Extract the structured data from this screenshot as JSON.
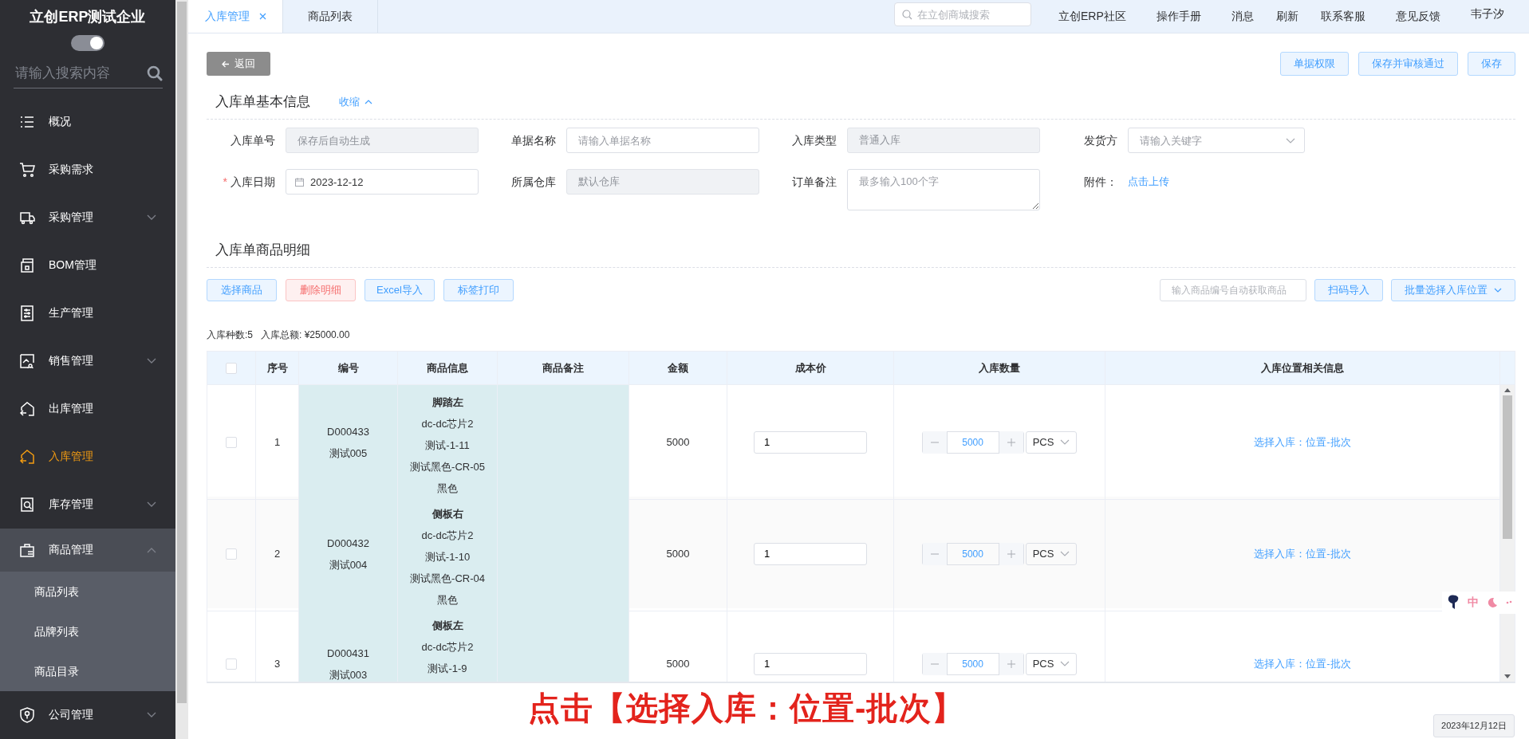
{
  "sidebar": {
    "title": "立创ERP测试企业",
    "toggle": {
      "on": true
    },
    "search": {
      "placeholder": "请输入搜索内容"
    },
    "items": [
      {
        "label": "概况",
        "selected": false
      },
      {
        "label": "采购需求",
        "selected": false
      },
      {
        "label": "采购管理",
        "selected": false,
        "expanded": false
      },
      {
        "label": "BOM管理",
        "selected": false
      },
      {
        "label": "生产管理",
        "selected": false
      },
      {
        "label": "销售管理",
        "selected": false,
        "expanded": false
      },
      {
        "label": "出库管理",
        "selected": false
      },
      {
        "label": "入库管理",
        "selected": true
      },
      {
        "label": "库存管理",
        "selected": false,
        "expanded": false
      },
      {
        "label": "商品管理",
        "selected": false,
        "expanded": true,
        "children": [
          {
            "label": "商品列表"
          },
          {
            "label": "品牌列表"
          },
          {
            "label": "商品目录"
          }
        ]
      },
      {
        "label": "公司管理",
        "selected": false,
        "expanded": false
      }
    ]
  },
  "tabs": [
    {
      "label": "入库管理",
      "selected": true,
      "closable": true
    },
    {
      "label": "商品列表",
      "selected": false,
      "closable": false
    }
  ],
  "header": {
    "search": {
      "placeholder": "在立创商城搜索"
    },
    "links": [
      "立创ERP社区",
      "操作手册",
      "消息",
      "刷新",
      "联系客服",
      "意见反馈"
    ],
    "user": "韦子汐"
  },
  "toolbar": {
    "back": "返回",
    "actions": [
      "单据权限",
      "保存并审核通过",
      "保存"
    ]
  },
  "basic_info": {
    "title": "入库单基本信息",
    "collapse": "收缩",
    "required_mark": "*",
    "fields": [
      {
        "label": "入库单号",
        "kind": "input",
        "disabled": true,
        "required": false,
        "placeholder": "保存后自动生成"
      },
      {
        "label": "单据名称",
        "kind": "input",
        "disabled": false,
        "required": false,
        "placeholder": "请输入单据名称"
      },
      {
        "label": "入库类型",
        "kind": "input",
        "disabled": true,
        "required": false,
        "value": "普通入库"
      },
      {
        "label": "发货方",
        "kind": "select",
        "disabled": false,
        "required": false,
        "placeholder": "请输入关键字"
      },
      {
        "label": "入库日期",
        "kind": "date",
        "disabled": false,
        "required": true,
        "value": "2023-12-12"
      },
      {
        "label": "所属仓库",
        "kind": "input",
        "disabled": true,
        "required": false,
        "value": "默认仓库"
      },
      {
        "label": "订单备注",
        "kind": "textarea",
        "disabled": false,
        "required": false,
        "placeholder": "最多输入100个字"
      },
      {
        "label": "附件：",
        "kind": "upload",
        "disabled": false,
        "required": false,
        "value": "点击上传"
      }
    ]
  },
  "details": {
    "title": "入库单商品明细",
    "buttons": [
      {
        "label": "选择商品",
        "kind": "primary"
      },
      {
        "label": "删除明细",
        "kind": "danger"
      },
      {
        "label": "Excel导入",
        "kind": "primary"
      },
      {
        "label": "标签打印",
        "kind": "primary"
      }
    ],
    "code_input": {
      "placeholder": "输入商品编号自动获取商品"
    },
    "scan": "扫码导入",
    "batch": "批量选择入库位置",
    "summary": [
      "入库种数:5",
      "入库总额: ¥25000.00"
    ]
  },
  "table": {
    "all_checked": false,
    "columns": [
      "序号",
      "编号",
      "商品信息",
      "商品备注",
      "金额",
      "成本价",
      "入库数量",
      "入库位置相关信息"
    ],
    "rows": [
      {
        "checked": false,
        "seq": "1",
        "code": [
          "D000433",
          "测试005"
        ],
        "name": "脚踏左",
        "info": [
          "dc-dc芯片2",
          "测试-1-11",
          "测试黑色-CR-05",
          "黑色"
        ],
        "amount": "5000",
        "cost": "1",
        "qty": "5000",
        "unit": "PCS",
        "location": "选择入库：位置-批次"
      },
      {
        "checked": false,
        "seq": "2",
        "code": [
          "D000432",
          "测试004"
        ],
        "name": "侧板右",
        "info": [
          "dc-dc芯片2",
          "测试-1-10",
          "测试黑色-CR-04",
          "黑色"
        ],
        "amount": "5000",
        "cost": "1",
        "qty": "5000",
        "unit": "PCS",
        "location": "选择入库：位置-批次"
      },
      {
        "checked": false,
        "seq": "3",
        "code": [
          "D000431",
          "测试003"
        ],
        "name": "侧板左",
        "info": [
          "dc-dc芯片2",
          "测试-1-9"
        ],
        "amount": "5000",
        "cost": "1",
        "qty": "5000",
        "unit": "PCS",
        "location": "选择入库：位置-批次"
      }
    ]
  },
  "caption": "点击【选择入库：位置-批次】",
  "ime": {
    "mode": "中"
  },
  "date_badge": "2023年12月12日"
}
